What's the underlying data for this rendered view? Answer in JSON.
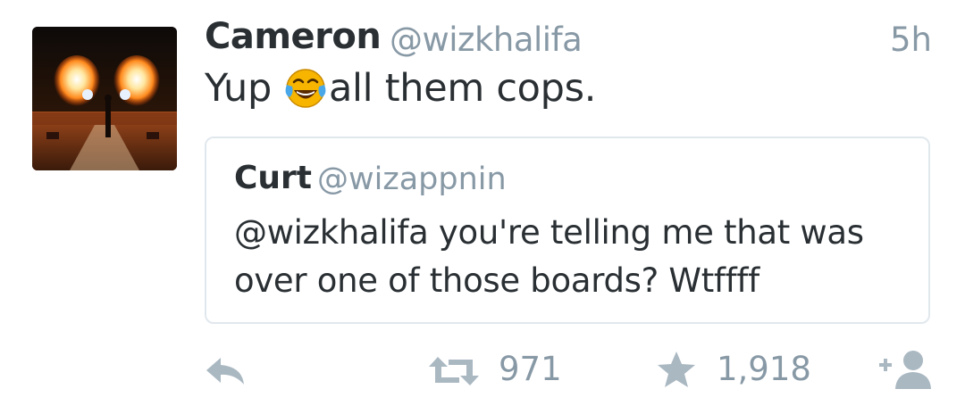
{
  "tweet": {
    "author": {
      "name": "Cameron",
      "handle": "@wizkhalifa"
    },
    "timestamp": "5h",
    "text_before_emoji": "Yup",
    "emoji": "face-with-tears-of-joy",
    "text_after_emoji": "all them cops.",
    "quoted_tweet": {
      "name": "Curt",
      "handle": "@wizappnin",
      "text": "@wizkhalifa you're telling me that was over one of those boards? Wtffff"
    },
    "actions": {
      "reply_icon": "reply-icon",
      "retweet_icon": "retweet-icon",
      "retweet_count": "971",
      "favorite_icon": "star-icon",
      "favorite_count": "1,918",
      "follow_icon": "follow-icon"
    }
  },
  "colors": {
    "text_primary": "#292f33",
    "text_secondary": "#8899a6",
    "action_icon": "#aab8c2",
    "border": "#e1e8ed",
    "emoji_yellow": "#f7b500",
    "emoji_tears": "#4aa8e8"
  }
}
